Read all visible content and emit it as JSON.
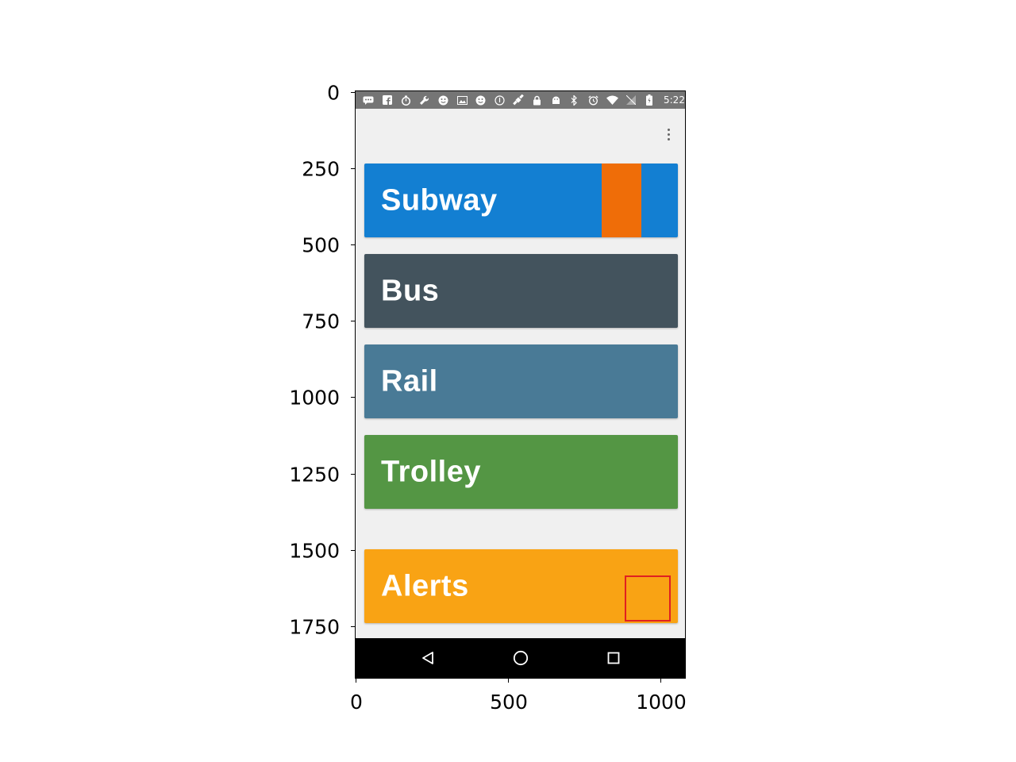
{
  "status_bar": {
    "icons": [
      "message-icon",
      "facebook-icon",
      "stopwatch-icon",
      "wrench-icon",
      "smiley-icon",
      "photo-icon",
      "smiley-icon",
      "info-icon",
      "satellite-icon",
      "lock-icon",
      "android-icon",
      "bluetooth-icon",
      "alarm-icon",
      "wifi-icon",
      "no-sim-icon",
      "battery-icon"
    ],
    "time": "5:22"
  },
  "menu": {
    "icon": "overflow-menu-icon"
  },
  "tiles": [
    {
      "label": "Subway",
      "color": "#137FD2"
    },
    {
      "label": "Bus",
      "color": "#43535D"
    },
    {
      "label": "Rail",
      "color": "#497A96"
    },
    {
      "label": "Trolley",
      "color": "#549644"
    },
    {
      "label": "Alerts",
      "color": "#F9A314"
    }
  ],
  "accents": {
    "subway_stripe": "#EF6D08",
    "highlight_box": "#E02020"
  },
  "nav_bar": {
    "icons": [
      "back-icon",
      "home-icon",
      "recents-icon"
    ]
  },
  "axes": {
    "y_ticks": [
      "0",
      "250",
      "500",
      "750",
      "1000",
      "1250",
      "1500",
      "1750"
    ],
    "x_ticks": [
      "0",
      "500",
      "1000"
    ]
  }
}
